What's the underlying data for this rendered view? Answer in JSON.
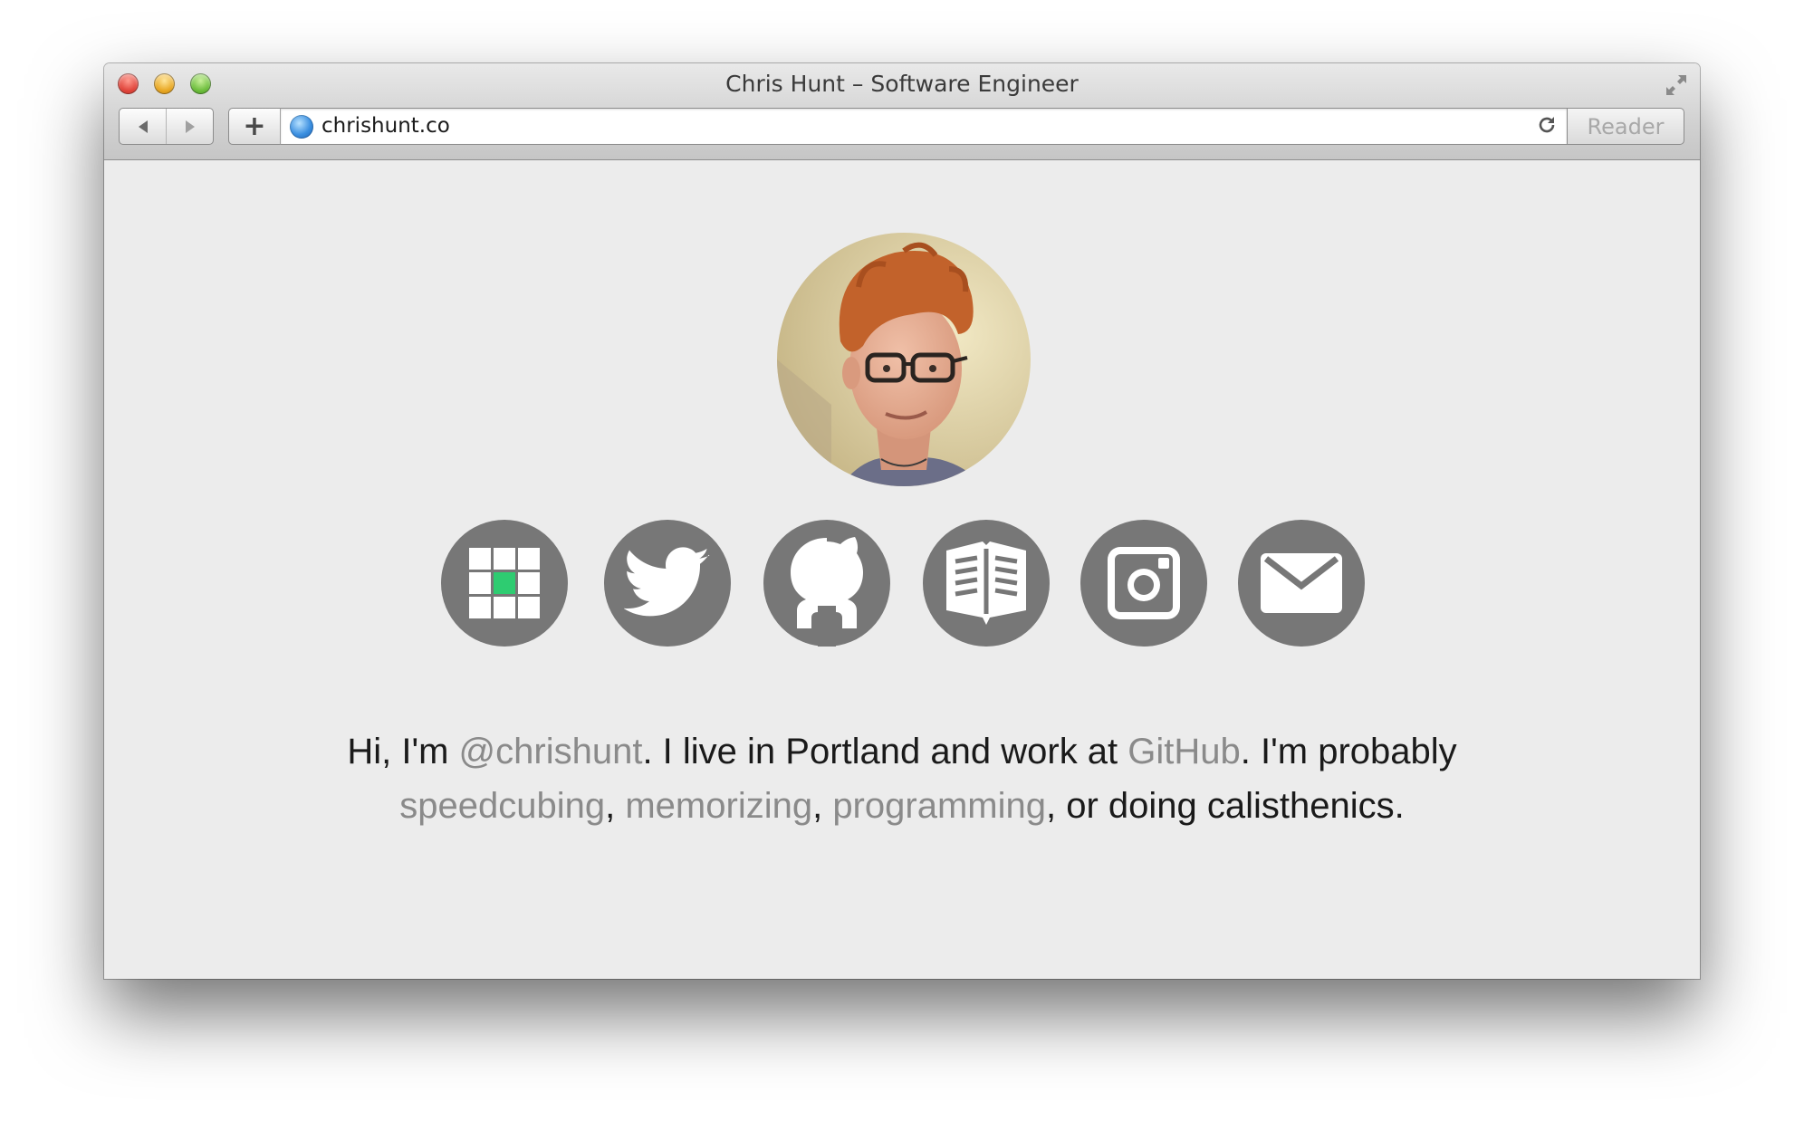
{
  "window": {
    "title": "Chris Hunt – Software Engineer"
  },
  "toolbar": {
    "back_icon": "back-arrow-icon",
    "forward_icon": "forward-arrow-icon",
    "new_tab_label": "+",
    "url": "chrishunt.co",
    "reload_icon": "reload-icon",
    "reader_label": "Reader"
  },
  "profile": {
    "avatar_alt": "avatar"
  },
  "social_links": [
    {
      "icon": "grid-cube-icon"
    },
    {
      "icon": "twitter-bird-icon"
    },
    {
      "icon": "github-octocat-icon"
    },
    {
      "icon": "open-book-icon"
    },
    {
      "icon": "instagram-camera-icon"
    },
    {
      "icon": "mail-envelope-icon"
    }
  ],
  "bio": {
    "p1": "Hi, I'm ",
    "handle": "@chrishunt",
    "p2": ". I live in Portland and work at ",
    "company": "GitHub",
    "p3": ". I'm probably ",
    "hobby1": "speedcubing",
    "sep1": ", ",
    "hobby2": "memorizing",
    "sep2": ", ",
    "hobby3": "programming",
    "p4": ", or doing calisthenics."
  },
  "colors": {
    "page_bg": "#ececec",
    "icon_circle": "#777777",
    "link": "#8a8a8a",
    "cube_accent": "#2ecc71"
  }
}
